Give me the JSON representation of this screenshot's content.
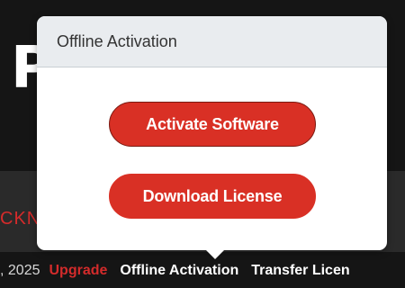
{
  "background": {
    "big_letter": "P",
    "red_text": "CKN",
    "footer": {
      "date": ", 2025",
      "upgrade_label": "Upgrade",
      "offline_activation_label": "Offline Activation",
      "transfer_license_label": "Transfer Licen"
    }
  },
  "popup": {
    "title": "Offline Activation",
    "activate_button_label": "Activate Software",
    "download_button_label": "Download License"
  },
  "colors": {
    "accent_red": "#d93025",
    "popup_header_bg": "#e9ecef",
    "page_bg": "#121212"
  }
}
